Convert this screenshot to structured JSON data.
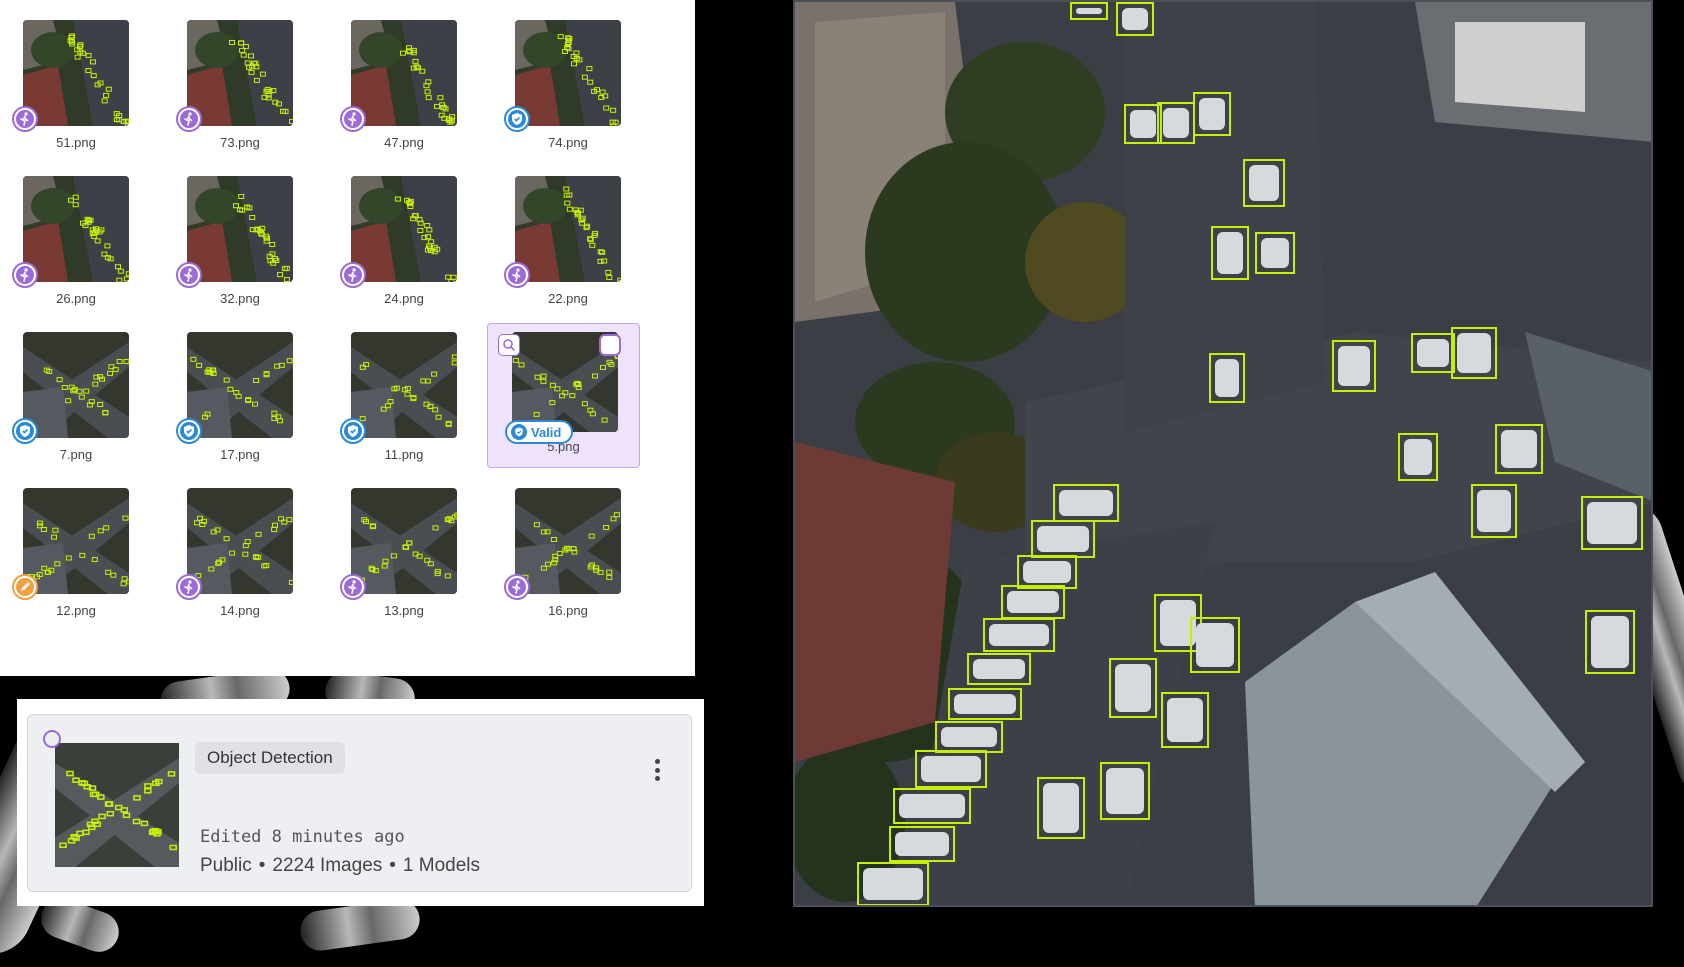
{
  "gallery": {
    "tiles": [
      {
        "name": "51.png",
        "status": "annotated",
        "scene": "a"
      },
      {
        "name": "73.png",
        "status": "annotated",
        "scene": "a"
      },
      {
        "name": "47.png",
        "status": "annotated",
        "scene": "a"
      },
      {
        "name": "74.png",
        "status": "validated",
        "scene": "a"
      },
      {
        "name": "26.png",
        "status": "annotated",
        "scene": "a"
      },
      {
        "name": "32.png",
        "status": "annotated",
        "scene": "a"
      },
      {
        "name": "24.png",
        "status": "annotated",
        "scene": "a"
      },
      {
        "name": "22.png",
        "status": "annotated",
        "scene": "a"
      },
      {
        "name": "7.png",
        "status": "validated",
        "scene": "b"
      },
      {
        "name": "17.png",
        "status": "validated",
        "scene": "b"
      },
      {
        "name": "11.png",
        "status": "validated",
        "scene": "b"
      },
      {
        "name": "5.png",
        "status": "validated",
        "scene": "b",
        "selected": true,
        "badge": "Valid"
      },
      {
        "name": "12.png",
        "status": "in-progress",
        "scene": "b"
      },
      {
        "name": "14.png",
        "status": "annotated",
        "scene": "b"
      },
      {
        "name": "13.png",
        "status": "annotated",
        "scene": "b"
      },
      {
        "name": "16.png",
        "status": "annotated",
        "scene": "b"
      }
    ]
  },
  "dataset_card": {
    "tag": "Object Detection",
    "edited": "Edited 8 minutes ago",
    "visibility": "Public",
    "images": "2224 Images",
    "models": "1 Models",
    "separator": "•"
  },
  "colors": {
    "accent_purple": "#9b6bd8",
    "valid_blue": "#2b8ad8",
    "progress_orange": "#f0a040",
    "bbox_green": "#c7f000"
  },
  "icons": {
    "annotated": "person-walking-icon",
    "validated": "shield-check-icon",
    "in-progress": "pencil-icon",
    "zoom": "magnifier-icon",
    "menu": "vertical-dots-icon"
  }
}
